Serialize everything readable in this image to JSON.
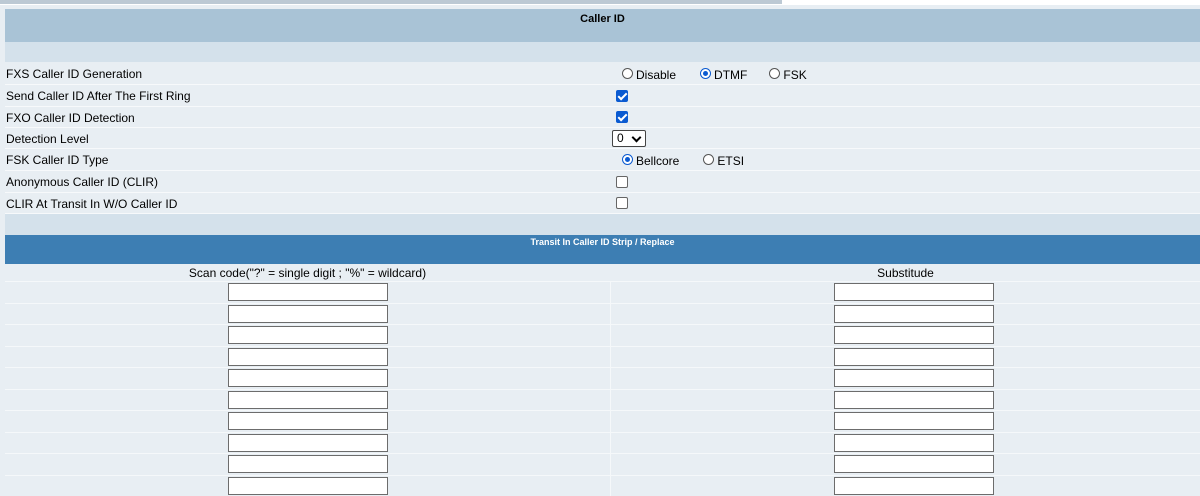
{
  "caller_id": {
    "title": "Caller ID",
    "settings": [
      {
        "label": "FXS Caller ID Generation",
        "control": "radio",
        "options": [
          {
            "label": "Disable",
            "selected": false
          },
          {
            "label": "DTMF",
            "selected": true
          },
          {
            "label": "FSK",
            "selected": false
          }
        ]
      },
      {
        "label": "Send Caller ID After The First Ring",
        "control": "checkbox",
        "checked": true
      },
      {
        "label": "FXO Caller ID Detection",
        "control": "checkbox",
        "checked": true
      },
      {
        "label": "Detection Level",
        "control": "select",
        "value": "0"
      },
      {
        "label": "FSK Caller ID Type",
        "control": "radio",
        "options": [
          {
            "label": "Bellcore",
            "selected": true
          },
          {
            "label": "ETSI",
            "selected": false
          }
        ]
      },
      {
        "label": "Anonymous Caller ID (CLIR)",
        "control": "checkbox",
        "checked": false
      },
      {
        "label": "CLIR At Transit In W/O Caller ID",
        "control": "checkbox",
        "checked": false
      }
    ]
  },
  "transit": {
    "title": "Transit In Caller ID Strip / Replace",
    "scan_header": "Scan code(\"?\" = single digit ; \"%\" = wildcard)",
    "substitute_header": "Substitude",
    "rows": [
      {
        "scan": "",
        "substitute": ""
      },
      {
        "scan": "",
        "substitute": ""
      },
      {
        "scan": "",
        "substitute": ""
      },
      {
        "scan": "",
        "substitute": ""
      },
      {
        "scan": "",
        "substitute": ""
      },
      {
        "scan": "",
        "substitute": ""
      },
      {
        "scan": "",
        "substitute": ""
      },
      {
        "scan": "",
        "substitute": ""
      },
      {
        "scan": "",
        "substitute": ""
      },
      {
        "scan": "",
        "substitute": ""
      }
    ]
  },
  "colors": {
    "caller_header": "#a9c3d6",
    "transit_header": "#3d7eb3",
    "accent": "#0a5ad1"
  }
}
